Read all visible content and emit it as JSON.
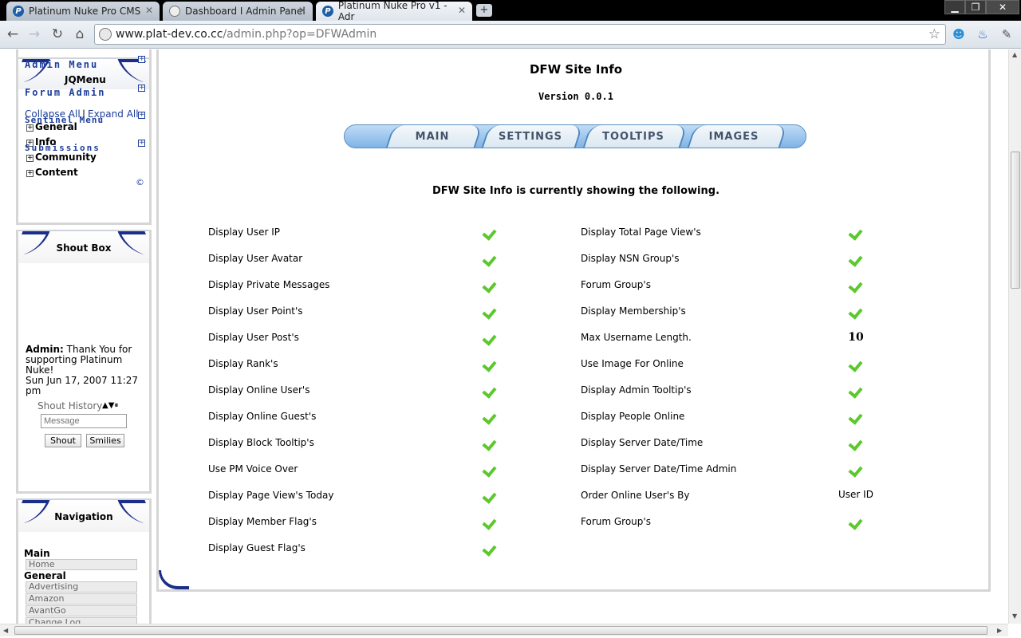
{
  "browser": {
    "tabs": [
      {
        "title": "Platinum Nuke Pro CMS",
        "favicon": "P"
      },
      {
        "title": "Dashboard I Admin Panel",
        "favicon": ""
      },
      {
        "title": "Platinum Nuke Pro v1 - Adr",
        "favicon": "P"
      }
    ],
    "new_tab": "+",
    "url_host": "www.plat-dev.co.cc",
    "url_path": "/admin.php?op=DFWAdmin",
    "window_controls": {
      "minimize": "▁",
      "maximize": "❐",
      "close": "✕"
    }
  },
  "sidebar": {
    "admin_menu": {
      "title": "Admin Menu",
      "jqmenu": "JQMenu",
      "forum_admin": "Forum Admin",
      "collapse_all": "Collapse All",
      "separator": "|",
      "expand_all": "Expand All",
      "sentinel_menu": "Sentinel Menu",
      "submissions": "Submissions",
      "tree": [
        "General",
        "Info",
        "Community",
        "Content"
      ],
      "copyright": "©"
    },
    "shout_box": {
      "title": "Shout Box",
      "author": "Admin:",
      "message": "Thank You for supporting Platinum Nuke!",
      "date": "Sun Jun 17, 2007 11:27 pm",
      "history_label": "Shout History",
      "input_placeholder": "Message",
      "shout_button": "Shout",
      "smilies_button": "Smilies"
    },
    "navigation": {
      "title": "Navigation",
      "sections": [
        {
          "label": "Main",
          "links": [
            "Home"
          ]
        },
        {
          "label": "General",
          "links": [
            "Advertising",
            "Amazon",
            "AvantGo",
            "Change Log"
          ]
        }
      ]
    }
  },
  "main": {
    "title": "DFW Site Info",
    "version": "Version 0.0.1",
    "tabs": [
      "MAIN",
      "SETTINGS",
      "TOOLTIPS",
      "IMAGES"
    ],
    "status_line": "DFW Site Info is currently showing the following.",
    "left_rows": [
      {
        "label": "Display User IP",
        "value": "check"
      },
      {
        "label": "Display User Avatar",
        "value": "check"
      },
      {
        "label": "Display Private Messages",
        "value": "check"
      },
      {
        "label": "Display User Point's",
        "value": "check"
      },
      {
        "label": "Display User Post's",
        "value": "check"
      },
      {
        "label": "Display Rank's",
        "value": "check"
      },
      {
        "label": "Display Online User's",
        "value": "check"
      },
      {
        "label": "Display Online Guest's",
        "value": "check"
      },
      {
        "label": "Display Block Tooltip's",
        "value": "check"
      },
      {
        "label": "Use PM Voice Over",
        "value": "check"
      },
      {
        "label": "Display Page View's Today",
        "value": "check"
      },
      {
        "label": "Display Member Flag's",
        "value": "check"
      },
      {
        "label": "Display Guest Flag's",
        "value": "check"
      }
    ],
    "right_rows": [
      {
        "label": "Display Total Page View's",
        "value": "check"
      },
      {
        "label": "Display NSN Group's",
        "value": "check"
      },
      {
        "label": "Forum Group's",
        "value": "check"
      },
      {
        "label": "Display Membership's",
        "value": "check"
      },
      {
        "label": "Max Username Length.",
        "value": "10"
      },
      {
        "label": "Use Image For Online",
        "value": "check"
      },
      {
        "label": "Display Admin Tooltip's",
        "value": "check"
      },
      {
        "label": "Display People Online",
        "value": "check"
      },
      {
        "label": "Display Server Date/Time",
        "value": "check"
      },
      {
        "label": "Display Server Date/Time Admin",
        "value": "check"
      },
      {
        "label": "Order Online User's By",
        "value": "User ID"
      },
      {
        "label": "Forum Group's",
        "value": "check"
      }
    ]
  },
  "colors": {
    "accent": "#1b3e9a",
    "check": "#5cc82c",
    "tab_blue": "#7fb4e6"
  }
}
